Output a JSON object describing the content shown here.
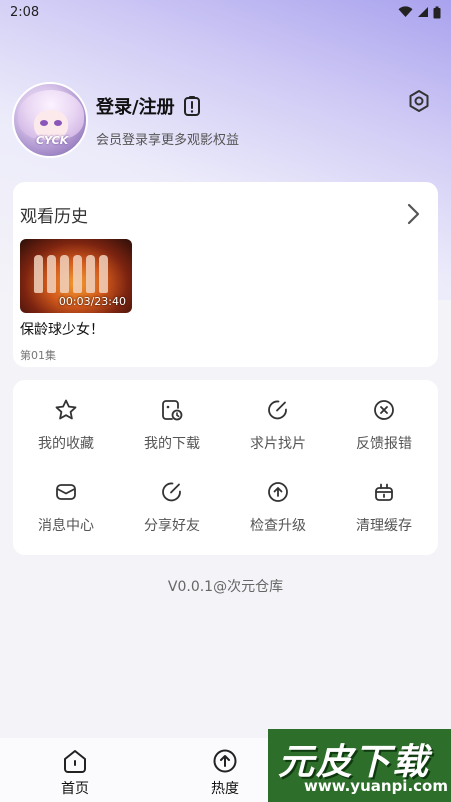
{
  "status_bar": {
    "time": "2:08"
  },
  "profile": {
    "avatar_tag": "CYCK",
    "title": "登录/注册",
    "subtitle": "会员登录享更多观影权益"
  },
  "history": {
    "header": "观看历史",
    "items": [
      {
        "title": "保龄球少女！",
        "episode": "第01集",
        "progress": "00:03/23:40"
      }
    ]
  },
  "menu": {
    "items": [
      {
        "label": "我的收藏",
        "icon": "star-icon"
      },
      {
        "label": "我的下载",
        "icon": "download-clock-icon"
      },
      {
        "label": "求片找片",
        "icon": "edit-circle-icon"
      },
      {
        "label": "反馈报错",
        "icon": "close-circle-icon"
      },
      {
        "label": "消息中心",
        "icon": "mail-icon"
      },
      {
        "label": "分享好友",
        "icon": "share-edit-icon"
      },
      {
        "label": "检查升级",
        "icon": "upgrade-icon"
      },
      {
        "label": "清理缓存",
        "icon": "clear-cache-icon"
      }
    ]
  },
  "version": "V0.0.1@次元仓库",
  "bottom_nav": {
    "items": [
      {
        "label": "首页",
        "icon": "home-icon"
      },
      {
        "label": "热度",
        "icon": "hot-icon"
      }
    ]
  },
  "watermark": {
    "main": "元皮下载",
    "url": "www.yuanpi.com"
  }
}
